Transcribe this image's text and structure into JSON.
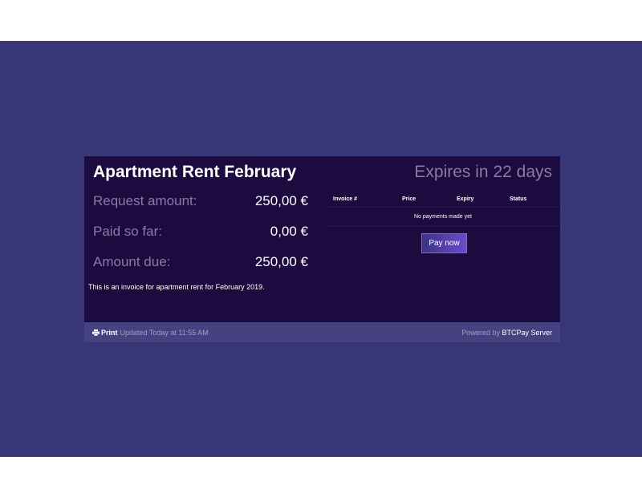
{
  "invoice": {
    "title": "Apartment Rent February",
    "expires": "Expires in 22 days",
    "amounts": [
      {
        "label": "Request amount:",
        "value": "250,00 €"
      },
      {
        "label": "Paid so far:",
        "value": "0,00 €"
      },
      {
        "label": "Amount due:",
        "value": "250,00 €"
      }
    ],
    "description": "This is an invoice for apartment rent for February 2019."
  },
  "payments_table": {
    "headers": [
      "Invoice #",
      "Price",
      "Expiry",
      "Status"
    ],
    "empty_message": "No payments made yet"
  },
  "actions": {
    "pay_now_label": "Pay now"
  },
  "footer": {
    "print_icon": "printer-icon",
    "print_label": "Print",
    "updated_text": "Updated Today at 11:55 AM",
    "powered_prefix": "Powered by",
    "powered_brand": "BTCPay Server"
  },
  "colors": {
    "page_bg": "#373676",
    "card_bg": "#1d0b3f",
    "footer_bg": "#46427f",
    "muted_text": "#8a7aa6",
    "button_gradient_start": "#3d3285",
    "button_gradient_end": "#6a4bc9"
  }
}
